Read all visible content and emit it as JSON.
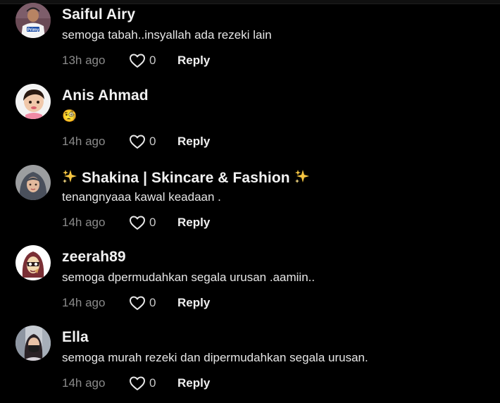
{
  "comments": [
    {
      "username": "Saiful Airy",
      "text": "semoga tabah..insyallah ada rezeki lain",
      "time": "13h ago",
      "likes": "0",
      "reply": "Reply",
      "avatar_badge": "Primy"
    },
    {
      "username": "Anis Ahmad",
      "text": "🧐",
      "time": "14h ago",
      "likes": "0",
      "reply": "Reply"
    },
    {
      "username_prefix": "✨",
      "username": "Shakina | Skincare & Fashion",
      "username_suffix": "✨",
      "text": "tenangnyaaa kawal keadaan .",
      "time": "14h ago",
      "likes": "0",
      "reply": "Reply"
    },
    {
      "username": "zeerah89",
      "text": "semoga dpermudahkan segala urusan .aamiin..",
      "time": "14h ago",
      "likes": "0",
      "reply": "Reply"
    },
    {
      "username": "Ella",
      "text": "semoga murah rezeki dan dipermudahkan segala urusan.",
      "time": "14h ago",
      "likes": "0",
      "reply": "Reply"
    }
  ],
  "colors": {
    "background": "#000000",
    "username": "#f2f2f2",
    "comment_text": "#e6e6e6",
    "timestamp": "#8a8a8a",
    "reply": "#f0f0f0",
    "sparkle": "#f5c542"
  },
  "icons": {
    "like": "heart-outline-icon",
    "sparkle": "sparkles-emoji"
  }
}
